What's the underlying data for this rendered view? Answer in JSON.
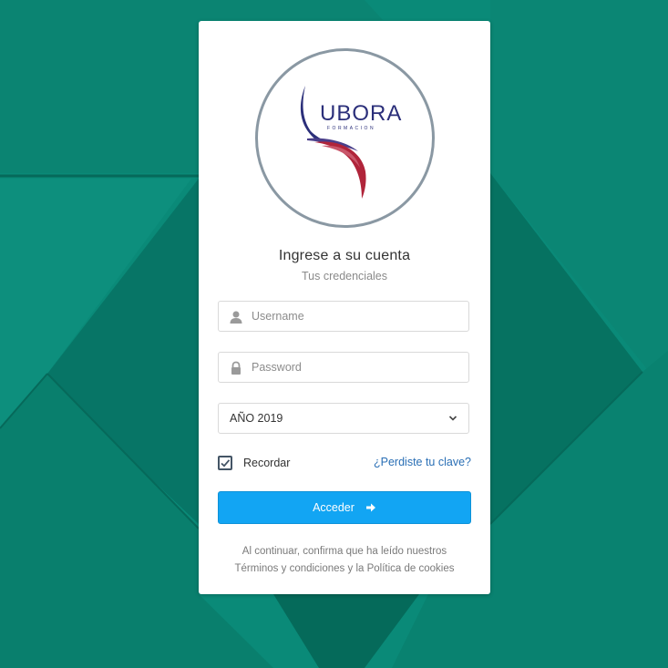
{
  "colors": {
    "background": "#0a8a78",
    "primary_button": "#12a5f3",
    "link": "#2a6fb5",
    "logo_navy": "#2b2f7a",
    "logo_red": "#b0243a"
  },
  "logo": {
    "text": "UBORA",
    "tagline": "FORMACION"
  },
  "login": {
    "title": "Ingrese a su cuenta",
    "subtitle": "Tus credenciales",
    "username": {
      "placeholder": "Username",
      "value": "",
      "icon": "user-icon"
    },
    "password": {
      "placeholder": "Password",
      "value": "",
      "icon": "lock-icon"
    },
    "year_select": {
      "value": "AÑO 2019",
      "icon": "chevron-down-icon"
    },
    "remember": {
      "label": "Recordar",
      "checked": true
    },
    "forgot_link": "¿Perdiste tu clave?",
    "submit": {
      "label": "Acceder",
      "icon": "arrow-right-icon"
    },
    "legal_line1": "Al continuar, confirma que ha leído nuestros",
    "legal_line2": "Términos y condiciones y la Política de cookies"
  }
}
